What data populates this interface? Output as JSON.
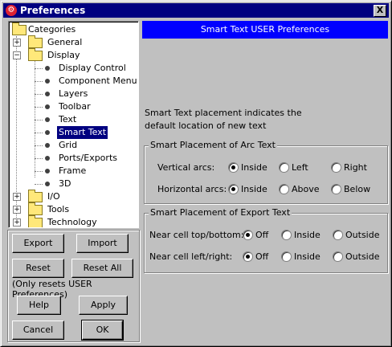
{
  "window": {
    "title": "Preferences",
    "app_icon": "app-logo-icon",
    "close_label": "X"
  },
  "tree": {
    "root": "Categories",
    "items": [
      {
        "label": "General"
      },
      {
        "label": "Display"
      },
      {
        "label": "Display Control"
      },
      {
        "label": "Component Menu"
      },
      {
        "label": "Layers"
      },
      {
        "label": "Toolbar"
      },
      {
        "label": "Text"
      },
      {
        "label": "Smart Text"
      },
      {
        "label": "Grid"
      },
      {
        "label": "Ports/Exports"
      },
      {
        "label": "Frame"
      },
      {
        "label": "3D"
      },
      {
        "label": "I/O"
      },
      {
        "label": "Tools"
      },
      {
        "label": "Technology"
      }
    ],
    "selected": "Smart Text"
  },
  "buttons": {
    "export": "Export",
    "import": "Import",
    "reset": "Reset",
    "reset_all": "Reset All",
    "reset_note": "(Only resets USER Preferences)",
    "help": "Help",
    "apply": "Apply",
    "cancel": "Cancel",
    "ok": "OK"
  },
  "panel": {
    "header": "Smart Text USER Preferences",
    "desc_line1": "Smart Text placement indicates the",
    "desc_line2": "default location of new text",
    "arc_group": {
      "title": "Smart Placement of Arc Text",
      "vertical_label": "Vertical arcs:",
      "vertical_options": [
        "Inside",
        "Left",
        "Right"
      ],
      "horizontal_label": "Horizontal arcs:",
      "horizontal_options": [
        "Inside",
        "Above",
        "Below"
      ]
    },
    "export_group": {
      "title": "Smart Placement of Export Text",
      "topbottom_label": "Near cell top/bottom:",
      "topbottom_options": [
        "Off",
        "Inside",
        "Outside"
      ],
      "leftright_label": "Near cell left/right:",
      "leftright_options": [
        "Off",
        "Inside",
        "Outside"
      ]
    }
  },
  "colors": {
    "title_bar": "#000080",
    "header": "#0000ff",
    "selection": "#000080"
  }
}
